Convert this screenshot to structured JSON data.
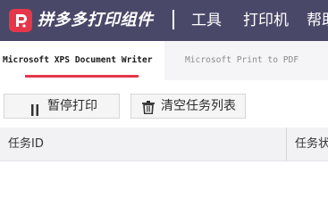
{
  "header": {
    "app_title": "拼多多打印组件",
    "menu": [
      "工具",
      "打印机",
      "帮助"
    ],
    "accent_color": "#e6374a",
    "background_color": "#4a4868"
  },
  "tabs": [
    {
      "label": "Microsoft XPS Document Writer",
      "active": true
    },
    {
      "label": "Microsoft Print to PDF",
      "active": false
    }
  ],
  "toolbar": {
    "pause_label": "暂停打印",
    "pause_icon": "pause-icon",
    "clear_label": "清空任务列表",
    "clear_icon": "trash-icon"
  },
  "table": {
    "columns": [
      "任务ID",
      "任务状态"
    ]
  }
}
